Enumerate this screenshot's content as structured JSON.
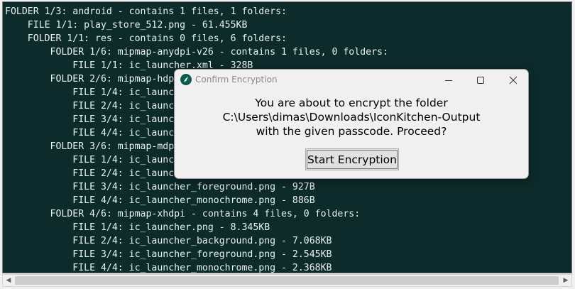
{
  "terminal": {
    "lines": [
      "FOLDER 1/3: android - contains 1 files, 1 folders:",
      "    FILE 1/1: play_store_512.png - 61.455KB",
      "    FOLDER 1/1: res - contains 0 files, 6 folders:",
      "        FOLDER 1/6: mipmap-anydpi-v26 - contains 1 files, 0 folders:",
      "            FILE 1/1: ic_launcher.xml - 328B",
      "        FOLDER 2/6: mipmap-hdpi",
      "            FILE 1/4: ic_launcher",
      "            FILE 2/4: ic_launcher",
      "            FILE 3/4: ic_launcher",
      "            FILE 4/4: ic_launcher",
      "        FOLDER 3/6: mipmap-mdpi",
      "            FILE 1/4: ic_launcher",
      "            FILE 2/4: ic_launcher",
      "            FILE 3/4: ic_launcher_foreground.png - 927B",
      "            FILE 4/4: ic_launcher_monochrome.png - 886B",
      "        FOLDER 4/6: mipmap-xhdpi - contains 4 files, 0 folders:",
      "            FILE 1/4: ic_launcher.png - 8.345KB",
      "            FILE 2/4: ic_launcher_background.png - 7.068KB",
      "            FILE 3/4: ic_launcher_foreground.png - 2.545KB",
      "            FILE 4/4: ic_launcher_monochrome.png - 2.368KB"
    ]
  },
  "dialog": {
    "title": "Confirm Encryption",
    "message_line1": "You are about to encrypt the folder",
    "message_line2": "C:\\Users\\dimas\\Downloads\\IconKitchen-Output",
    "message_line3": "with the given passcode. Proceed?",
    "button_label": "Start Encryption",
    "app_icon": "app-logo-icon",
    "window_buttons": [
      "minimize-icon",
      "maximize-icon",
      "close-icon"
    ]
  },
  "scrollbar": {
    "left_arrow": "◀",
    "right_arrow": "▶"
  },
  "colors": {
    "terminal_bg": "#0d2b2b",
    "terminal_text": "#e8f2ee",
    "dialog_bg": "#f0f0f0",
    "app_icon_bg": "#0f5b52"
  }
}
